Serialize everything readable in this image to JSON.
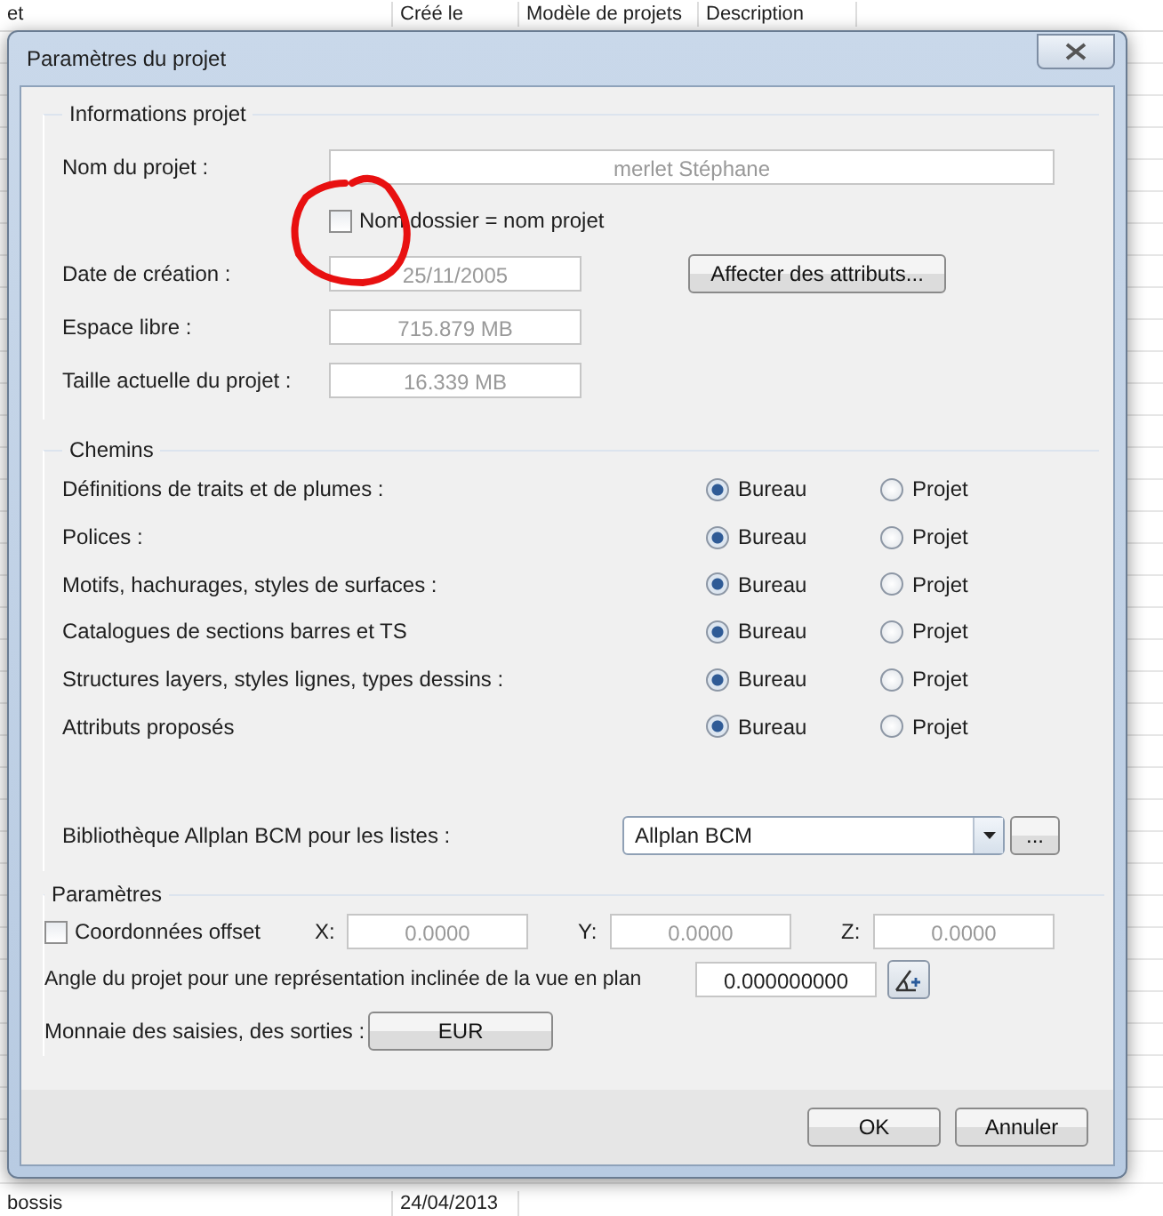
{
  "background_table": {
    "columns": [
      "et",
      "Créé le",
      "Modèle de projets",
      "Description"
    ],
    "rows": [
      [
        "bossis",
        "24/04/2013"
      ]
    ]
  },
  "window": {
    "title": "Paramètres du projet"
  },
  "project_info": {
    "title": "Informations projet",
    "name_label": "Nom du projet :",
    "name_value": "merlet Stéphane",
    "folder_checkbox": {
      "label": "Nom dossier = nom projet",
      "checked": false
    },
    "fields": [
      {
        "label": "Date de création :",
        "value": "25/11/2005"
      },
      {
        "label": "Espace libre :",
        "value": "715.879 MB"
      },
      {
        "label": "Taille actuelle du projet :",
        "value": "16.339 MB"
      }
    ],
    "attributes_button": "Affecter des attributs..."
  },
  "paths": {
    "title": "Chemins",
    "rows": [
      {
        "label": "Définitions de traits et de plumes :",
        "options": [
          {
            "label": "Bureau",
            "selected": true
          },
          {
            "label": "Projet",
            "selected": false
          }
        ]
      },
      {
        "label": "Polices :",
        "options": [
          {
            "label": "Bureau",
            "selected": true
          },
          {
            "label": "Projet",
            "selected": false
          }
        ]
      },
      {
        "label": "Motifs, hachurages, styles de surfaces :",
        "options": [
          {
            "label": "Bureau",
            "selected": true
          },
          {
            "label": "Projet",
            "selected": false
          }
        ]
      },
      {
        "label": "Catalogues de sections barres et TS",
        "options": [
          {
            "label": "Bureau",
            "selected": true
          },
          {
            "label": "Projet",
            "selected": false
          }
        ]
      },
      {
        "label": "Structures layers, styles lignes, types dessins :",
        "options": [
          {
            "label": "Bureau",
            "selected": true
          },
          {
            "label": "Projet",
            "selected": false
          }
        ]
      },
      {
        "label": "Attributs proposés",
        "options": [
          {
            "label": "Bureau",
            "selected": true
          },
          {
            "label": "Projet",
            "selected": false
          }
        ]
      }
    ],
    "library_label": "Bibliothèque Allplan BCM pour les listes :",
    "library_value": "Allplan BCM",
    "browse_button": "..."
  },
  "parameters": {
    "title": "Paramètres",
    "offset_checkbox": {
      "label": "Coordonnées offset",
      "checked": false
    },
    "coords": [
      {
        "label": "X:",
        "value": "0.0000"
      },
      {
        "label": "Y:",
        "value": "0.0000"
      },
      {
        "label": "Z:",
        "value": "0.0000"
      }
    ],
    "angle_label": "Angle du projet pour une représentation inclinée de la vue en plan",
    "angle_value": "0.000000000",
    "currency_label": "Monnaie des saisies, des sorties :",
    "currency_button": "EUR"
  },
  "buttons": [
    "OK",
    "Annuler"
  ]
}
